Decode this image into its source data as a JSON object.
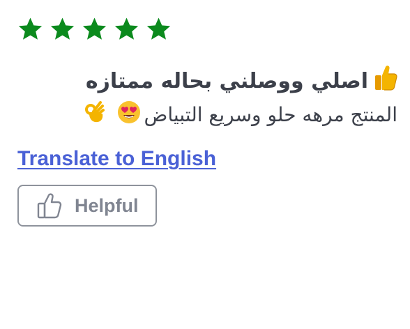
{
  "review": {
    "rating": 5,
    "rating_max": 5,
    "star_color": "#0b8a1d",
    "title_text": "اصلي ووصلني بحاله ممتازه",
    "title_emoji": "thumbs-up-icon",
    "body_text_1": "المنتج مرهه حلو وسريع التبياض",
    "body_emoji_1": "heart-eyes-icon",
    "body_emoji_2": "ok-hand-icon",
    "translate_label": "Translate to English",
    "link_color": "#4a61d6",
    "helpful_label": "Helpful",
    "helpful_icon": "thumbs-up-outline-icon"
  }
}
